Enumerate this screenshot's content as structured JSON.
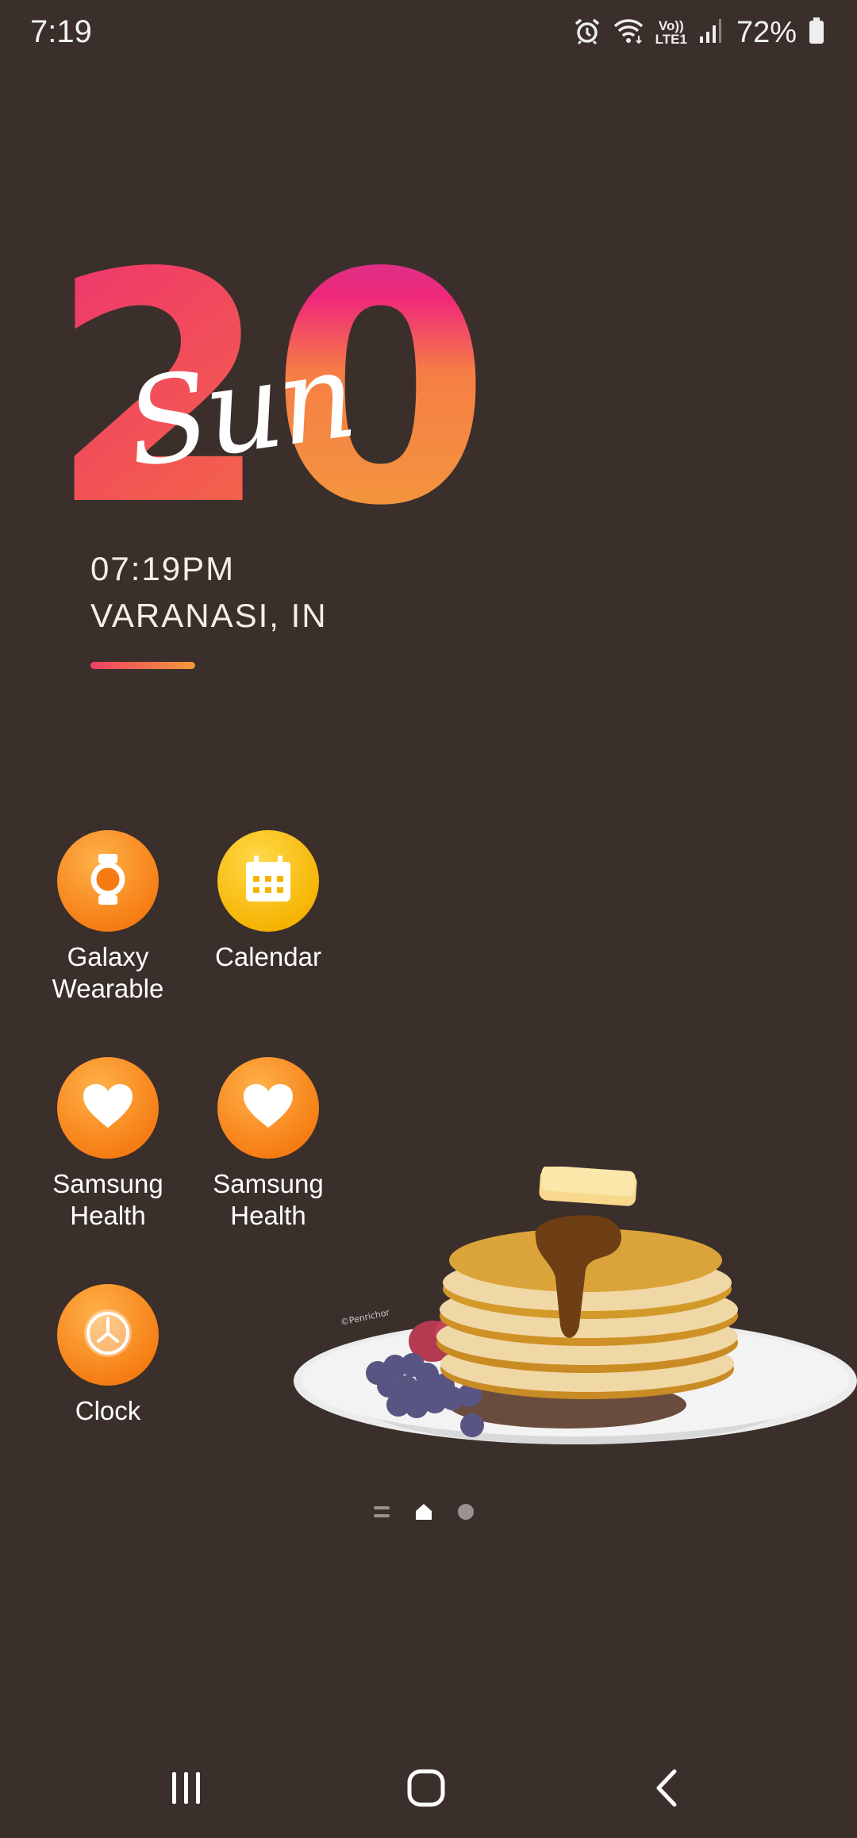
{
  "status_bar": {
    "time": "7:19",
    "network_label_top": "Vo))",
    "network_label_bottom": "LTE1",
    "battery_percent": "72%",
    "icons": [
      "alarm-icon",
      "wifi-icon",
      "volte-icon",
      "signal-icon",
      "battery-icon"
    ]
  },
  "widget": {
    "date_number": "20",
    "day": "Sun",
    "time": "07:19PM",
    "location": "VARANASI, IN",
    "accent_colors": [
      "#ef3e63",
      "#f29a3a"
    ]
  },
  "apps": [
    {
      "label": "Galaxy\nWearable",
      "icon": "watch-icon"
    },
    {
      "label": "Calendar",
      "icon": "calendar-icon"
    },
    {
      "label": "Samsung\nHealth",
      "icon": "heart-icon"
    },
    {
      "label": "Samsung\nHealth",
      "icon": "heart-icon"
    },
    {
      "label": "Clock",
      "icon": "clock-icon"
    }
  ],
  "wallpaper": {
    "signature": "©Penrichor"
  },
  "page_indicator": {
    "pages": [
      "menu",
      "home",
      "page-2"
    ],
    "active": "home"
  },
  "nav_bar": {
    "buttons": [
      "recents",
      "home",
      "back"
    ]
  }
}
